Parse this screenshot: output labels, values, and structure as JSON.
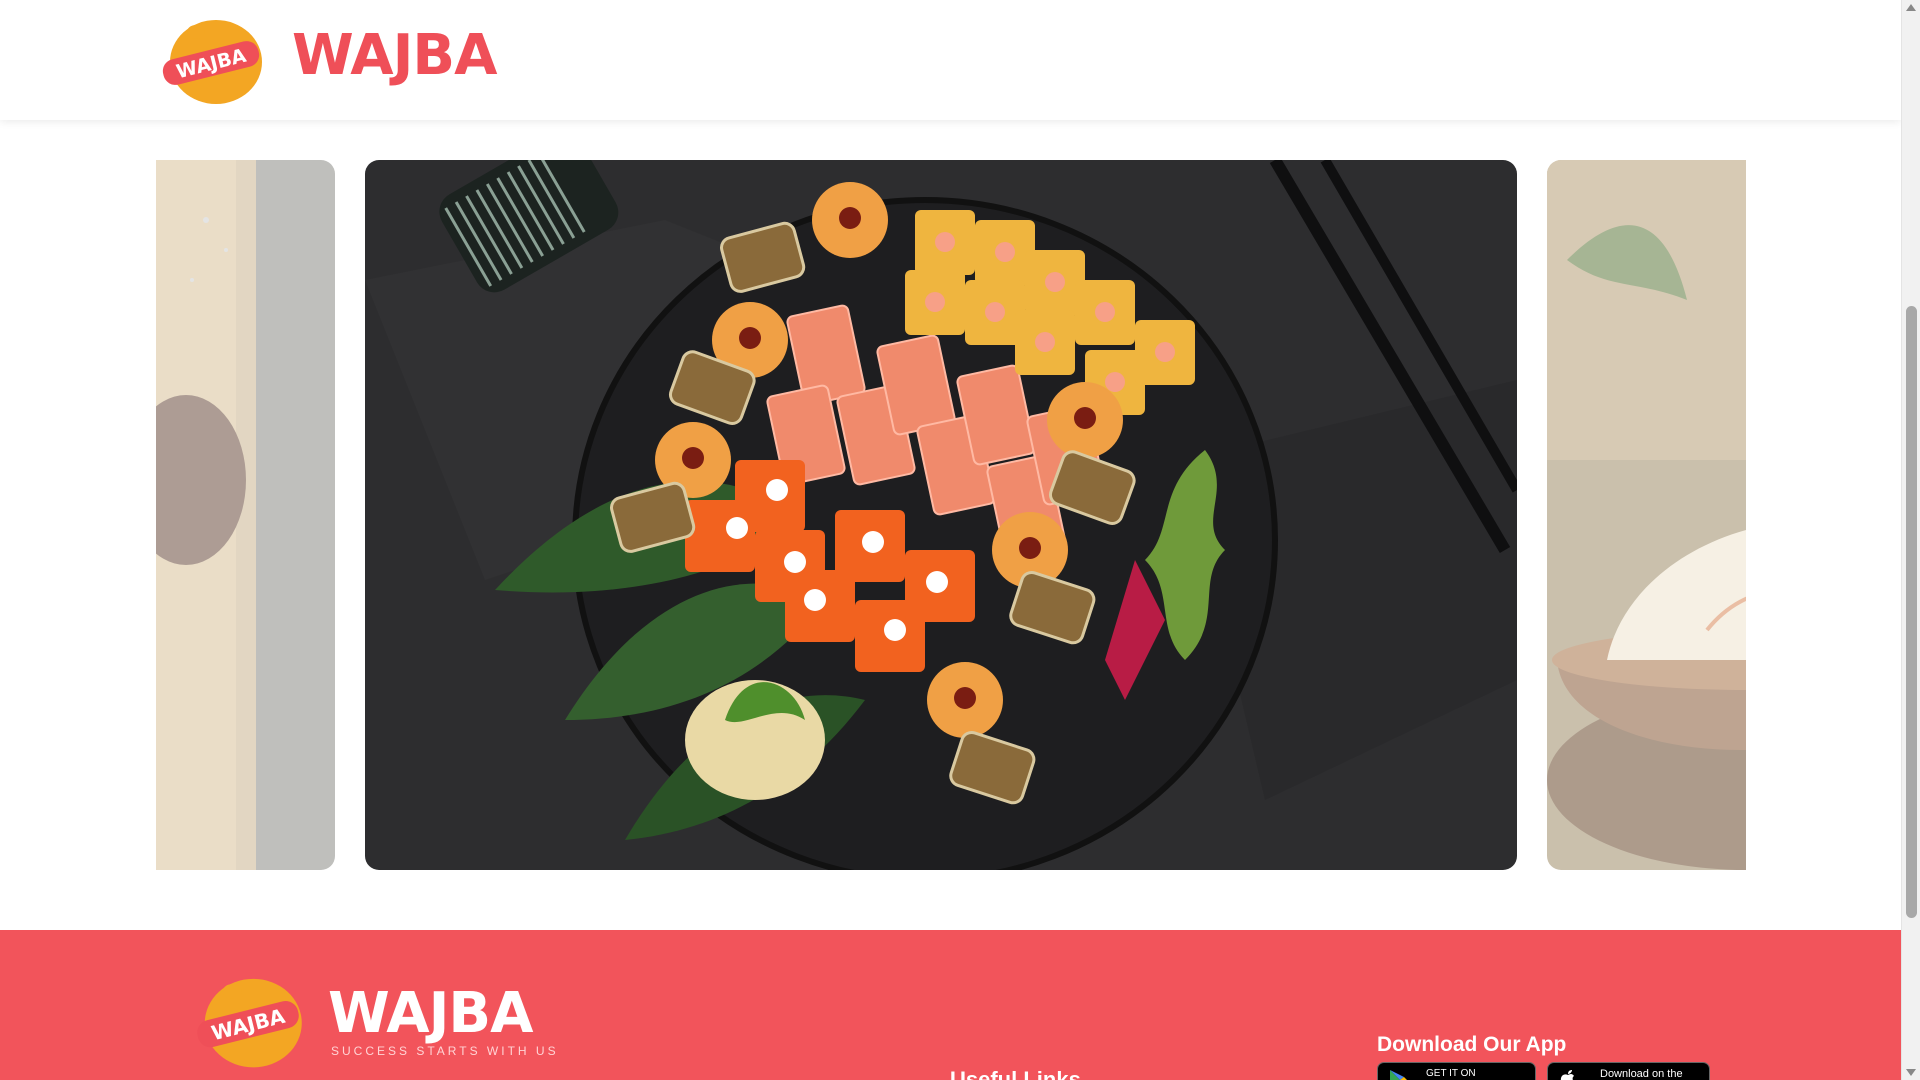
{
  "header": {
    "logo_badge_text": "WAJBA",
    "brand_name": "WAJBA"
  },
  "carousel": {
    "slides": [
      {
        "label": "wooden-board-dish"
      },
      {
        "label": "sushi-platter"
      },
      {
        "label": "rice-bowl-dish"
      }
    ]
  },
  "footer": {
    "logo_badge_text": "WAJBA",
    "brand_name": "WAJBA",
    "tagline": "SUCCESS STARTS WITH US",
    "useful_links_title": "Useful Links",
    "download_title": "Download Our App",
    "google_play_label": "GET IT ON",
    "app_store_label": "Download on the"
  },
  "colors": {
    "brand_red": "#ef4f58",
    "footer_bg": "#f2545b",
    "badge_orange": "#f3a623"
  }
}
